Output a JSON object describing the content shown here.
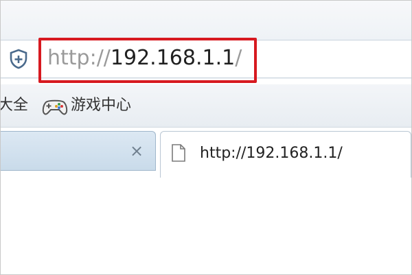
{
  "address_bar": {
    "url_protocol": "http://",
    "url_host": "192.168.1.1",
    "url_trailing": "/"
  },
  "bookmarks": {
    "partial_item": "大全",
    "games_item": "游戏中心"
  },
  "tabs": [
    {
      "label": ""
    },
    {
      "label": "http://192.168.1.1/"
    }
  ],
  "icons": {
    "security": "shield-plus-icon",
    "games": "gamepad-icon",
    "page": "page-icon",
    "close": "close-icon"
  },
  "colors": {
    "highlight": "#d71920",
    "url_gray": "#9a9a9a",
    "tab_blue": "#c9dbea"
  },
  "close_glyph": "×"
}
